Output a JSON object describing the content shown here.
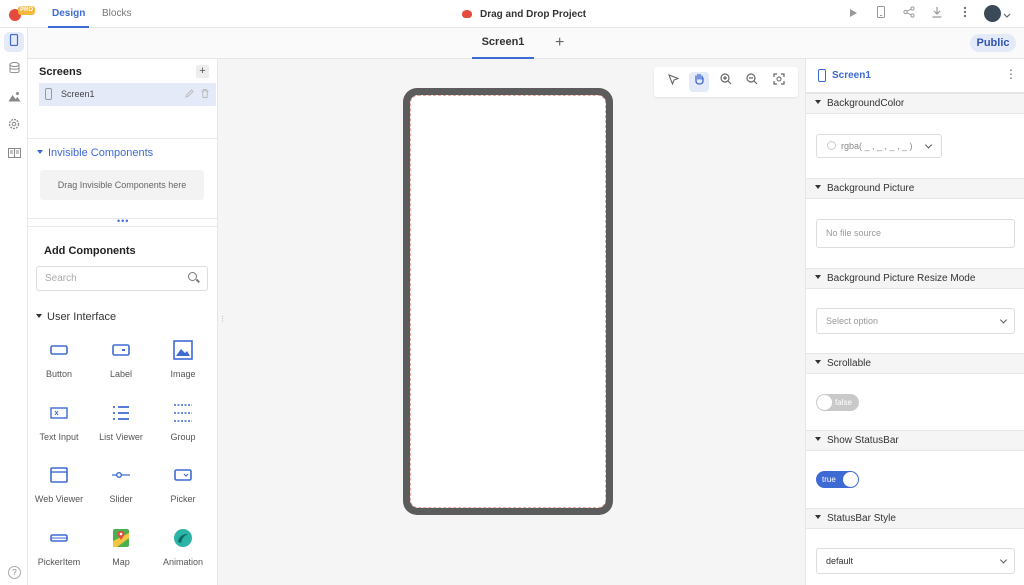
{
  "topbar": {
    "pro_badge": "PRO",
    "tabs": [
      {
        "label": "Design"
      },
      {
        "label": "Blocks"
      }
    ],
    "project_title": "Drag and Drop Project"
  },
  "screen_tabs": {
    "active": "Screen1",
    "add": "+",
    "visibility": "Public"
  },
  "left_panel": {
    "screens_title": "Screens",
    "add_screen": "+",
    "screens": [
      {
        "name": "Screen1"
      }
    ],
    "invisible_title": "Invisible Components",
    "invisible_drop_hint": "Drag Invisible Components here",
    "add_components_title": "Add Components",
    "search_placeholder": "Search",
    "category": "User Interface",
    "components": [
      {
        "label": "Button",
        "icon": "button-icon"
      },
      {
        "label": "Label",
        "icon": "label-icon"
      },
      {
        "label": "Image",
        "icon": "image-icon"
      },
      {
        "label": "Text Input",
        "icon": "text-input-icon"
      },
      {
        "label": "List Viewer",
        "icon": "list-viewer-icon"
      },
      {
        "label": "Group",
        "icon": "group-icon"
      },
      {
        "label": "Web Viewer",
        "icon": "web-viewer-icon"
      },
      {
        "label": "Slider",
        "icon": "slider-icon"
      },
      {
        "label": "Picker",
        "icon": "picker-icon"
      },
      {
        "label": "PickerItem",
        "icon": "picker-item-icon"
      },
      {
        "label": "Map",
        "icon": "map-icon"
      },
      {
        "label": "Animation",
        "icon": "animation-icon"
      }
    ]
  },
  "right_panel": {
    "selected": "Screen1",
    "properties": {
      "background_color": {
        "title": "BackgroundColor",
        "value": "rgba( _ , _ , _ , _ )"
      },
      "background_picture": {
        "title": "Background Picture",
        "placeholder": "No file source"
      },
      "resize_mode": {
        "title": "Background Picture Resize Mode",
        "placeholder": "Select option"
      },
      "scrollable": {
        "title": "Scrollable",
        "value": "false"
      },
      "show_statusbar": {
        "title": "Show StatusBar",
        "value": "true"
      },
      "statusbar_style": {
        "title": "StatusBar Style",
        "value": "default"
      }
    }
  },
  "help": "?",
  "colors": {
    "accent": "#3e6ad4",
    "brand": "#e34b3c",
    "pro": "#f3b83c",
    "phone_frame": "#5c5c5c"
  }
}
